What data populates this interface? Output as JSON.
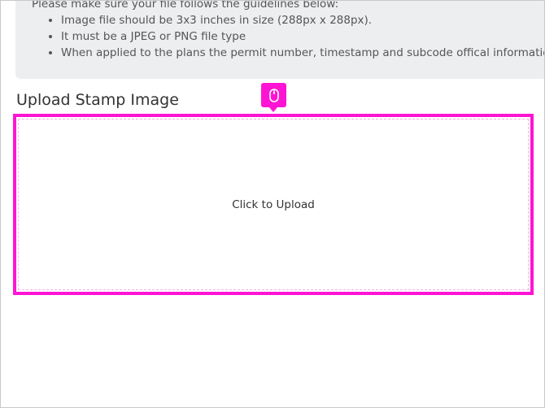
{
  "guidelines": {
    "intro": "Please make sure your file follows the guidelines below:",
    "items": [
      "Image file should be 3x3 inches in size (288px x 288px).",
      "It must be a JPEG or PNG file type",
      "When applied to the plans the permit number, timestamp and subcode offical information will be included"
    ]
  },
  "upload": {
    "title": "Upload Stamp Image",
    "dropzone_label": "Click to Upload"
  },
  "marker": {
    "icon": "mouse-icon",
    "color": "#ff14d4"
  }
}
